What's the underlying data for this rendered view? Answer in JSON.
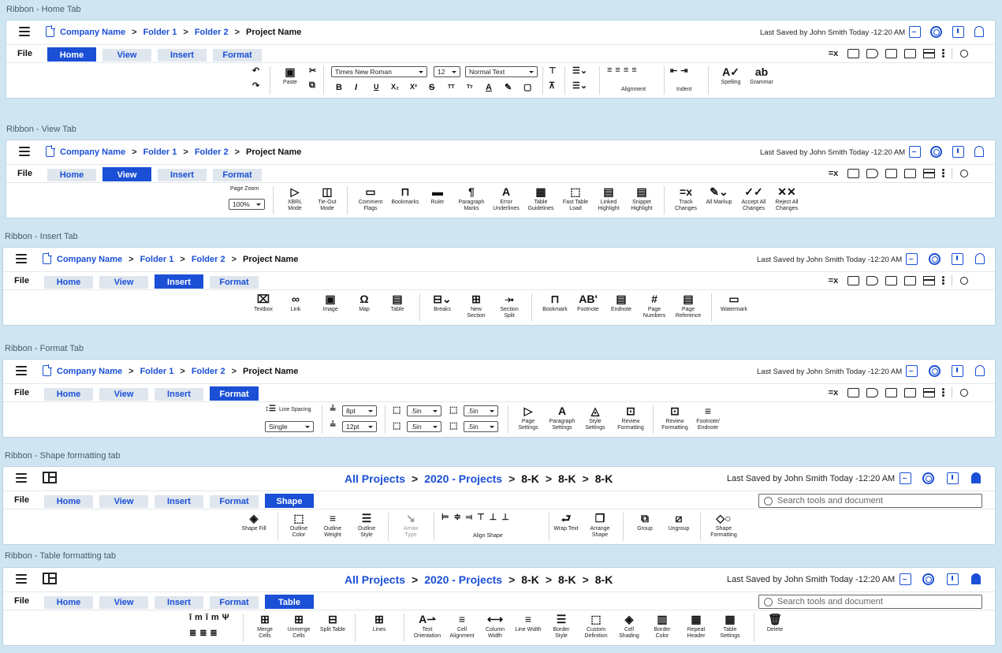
{
  "labels": {
    "home": "Ribbon - Home Tab",
    "view": "Ribbon - View Tab",
    "insert": "Ribbon - Insert Tab",
    "format": "Ribbon - Format Tab",
    "shape": "Ribbon - Shape formatting tab",
    "table": "Ribbon - Table formatting tab"
  },
  "header": {
    "crumbs": [
      "Company Name",
      "Folder 1",
      "Folder 2"
    ],
    "current": "Project Name",
    "crumbs_big": [
      "All Projects",
      "2020 - Projects"
    ],
    "big_rest": [
      "8-K",
      "8-K",
      "8-K"
    ],
    "sep": ">",
    "saved": "Last Saved by John Smith Today -12:20 AM"
  },
  "tabs": {
    "file": "File",
    "home": "Home",
    "view": "View",
    "insert": "Insert",
    "format": "Format",
    "shape": "Shape",
    "table": "Table"
  },
  "search": {
    "placeholder": "Search tools and document"
  },
  "home_ribbon": {
    "paste": "Paste",
    "font": "Times New Roman",
    "size": "12",
    "style": "Normal Text",
    "alignment": "Alignment",
    "indent": "Indent",
    "spelling": "Spelling",
    "grammar": "Grammar",
    "glyphs": [
      "B",
      "I",
      "U",
      "X₂",
      "X²",
      "S",
      "TT",
      "Tт",
      "A"
    ]
  },
  "view_ribbon": {
    "page_zoom": "Page Zoom",
    "zoom": "100%",
    "tools": [
      "XBRL Mode",
      "Tie-Out Mode",
      "Comment Flags",
      "Bookmarks",
      "Ruler",
      "Paragraph Marks",
      "Error Underlines",
      "Table Guidelines",
      "Fast Table Load",
      "Linked Highlight",
      "Snippet Highlight",
      "Track Changes",
      "All Markup",
      "Accept All Changes",
      "Reject All Changes"
    ]
  },
  "insert_ribbon": {
    "tools": [
      "Textbox",
      "Link",
      "Image",
      "Map",
      "Table",
      "Breaks",
      "New Section",
      "Section Split",
      "Bookmark",
      "Footnote",
      "Endnote",
      "Page Numbers",
      "Page Reference",
      "Watermark"
    ]
  },
  "format_ribbon": {
    "line_spacing": "Line Spacing",
    "spacing": "Single",
    "before": "8pt",
    "after": "12pt",
    "m1": ".5in",
    "m2": ".5in",
    "m3": ".5in",
    "m4": ".5in",
    "tools": [
      "Page Settings",
      "Paragraph Settings",
      "Style Settings",
      "Review Formatting",
      "Review Formatting",
      "Footnote/ Endnote"
    ]
  },
  "shape_ribbon": {
    "tools": [
      "Shape Fill",
      "Outline Color",
      "Outline Weight",
      "Outline Style",
      "Arrow Type",
      "Align Shape",
      "Wrap Text",
      "Arrange Shape",
      "Group",
      "Ungroup",
      "Shape Formatting"
    ]
  },
  "table_ribbon": {
    "tools": [
      "Merge Cells",
      "Unmerge Cells",
      "Split Table",
      "Lines",
      "Text Orientation",
      "Cell Alignment",
      "Column Width",
      "Line Width",
      "Border Style",
      "Custom Definition",
      "Cell Shading",
      "Border Color",
      "Repeat Header",
      "Table Settings",
      "Delete"
    ]
  }
}
